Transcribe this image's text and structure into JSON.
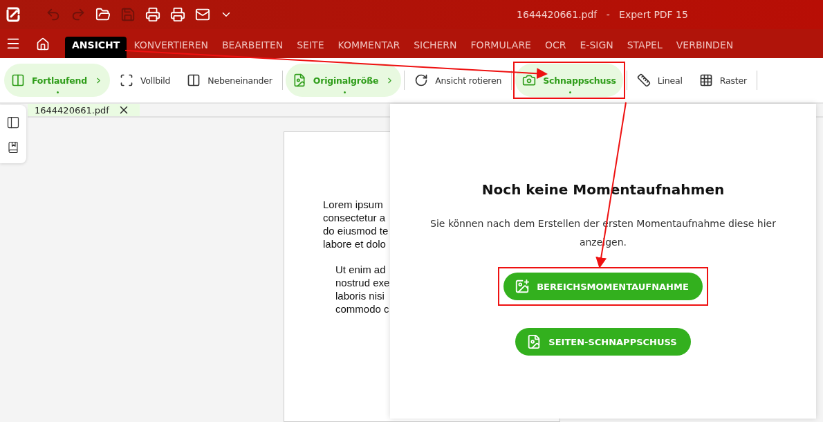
{
  "window": {
    "title": "1644420661.pdf   -   Expert PDF 15"
  },
  "quick_access": [
    {
      "kind": "undo",
      "disabled": true
    },
    {
      "kind": "redo",
      "disabled": true
    },
    {
      "kind": "open",
      "disabled": false
    },
    {
      "kind": "save",
      "disabled": true
    },
    {
      "kind": "print",
      "disabled": false
    },
    {
      "kind": "print-area",
      "disabled": false
    },
    {
      "kind": "mail",
      "disabled": false
    },
    {
      "kind": "more",
      "disabled": false
    }
  ],
  "menu_tabs": [
    {
      "label": "ANSICHT",
      "selected": true
    },
    {
      "label": "KONVERTIEREN",
      "selected": false
    },
    {
      "label": "BEARBEITEN",
      "selected": false
    },
    {
      "label": "SEITE",
      "selected": false
    },
    {
      "label": "KOMMENTAR",
      "selected": false
    },
    {
      "label": "SICHERN",
      "selected": false
    },
    {
      "label": "FORMULARE",
      "selected": false
    },
    {
      "label": "OCR",
      "selected": false
    },
    {
      "label": "E-SIGN",
      "selected": false
    },
    {
      "label": "STAPEL",
      "selected": false
    },
    {
      "label": "VERBINDEN",
      "selected": false
    }
  ],
  "toolbar": [
    {
      "kind": "continuous",
      "label": "Fortlaufend",
      "selected": true,
      "expandable": true,
      "highlighted": false
    },
    {
      "kind": "fullscreen",
      "label": "Vollbild",
      "selected": false,
      "expandable": false,
      "highlighted": false
    },
    {
      "kind": "side-by-side",
      "label": "Nebeneinander",
      "selected": false,
      "expandable": false,
      "highlighted": false
    },
    {
      "kind": "actual-size",
      "label": "Originalgröße",
      "selected": true,
      "expandable": true,
      "highlighted": false
    },
    {
      "kind": "rotate",
      "label": "Ansicht rotieren",
      "selected": false,
      "expandable": false,
      "highlighted": false
    },
    {
      "kind": "snapshot",
      "label": "Schnappschuss",
      "selected": true,
      "expandable": false,
      "highlighted": true
    },
    {
      "kind": "ruler",
      "label": "Lineal",
      "selected": false,
      "expandable": false,
      "highlighted": false
    },
    {
      "kind": "grid",
      "label": "Raster",
      "selected": false,
      "expandable": false,
      "highlighted": false
    }
  ],
  "document_tab": {
    "label": "1644420661.pdf"
  },
  "page_paragraphs": [
    [
      "Lorem ipsum",
      "consectetur a",
      "do eiusmod te",
      "labore et dolo"
    ],
    [
      "Ut enim ad",
      "nostrud exe",
      "laboris nisi",
      "commodo c"
    ]
  ],
  "snapshot_panel": {
    "title": "Noch keine Momentaufnahmen",
    "message": "Sie können nach dem Erstellen der ersten Momentaufnahme diese hier anzeigen.",
    "buttons": [
      {
        "kind": "area",
        "label": "BEREICHSMOMENTAUFNAHME",
        "highlighted": true
      },
      {
        "kind": "page",
        "label": "SEITEN-SCHNAPPSCHUSS",
        "highlighted": false
      }
    ]
  }
}
